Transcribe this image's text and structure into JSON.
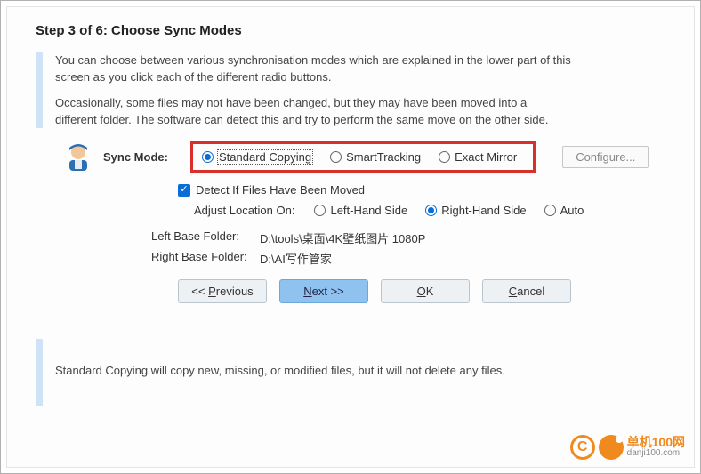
{
  "title": "Step 3 of 6: Choose Sync Modes",
  "intro": {
    "p1": "You can choose between various synchronisation modes which are explained in the lower part of this screen as you click each of the different radio buttons.",
    "p2": "Occasionally, some files may not have been changed, but they may have been moved into a different folder. The software can detect this and try to perform the same move on the other side."
  },
  "syncMode": {
    "label": "Sync Mode:",
    "options": {
      "standard": "Standard Copying",
      "smart": "SmartTracking",
      "exact": "Exact Mirror"
    },
    "configure": "Configure..."
  },
  "detect": {
    "label": "Detect If Files Have Been Moved"
  },
  "adjust": {
    "label": "Adjust Location On:",
    "left": "Left-Hand Side",
    "right": "Right-Hand Side",
    "auto": "Auto"
  },
  "paths": {
    "leftLabel": "Left Base Folder:",
    "leftValue": "D:\\tools\\桌面\\4K壁纸图片 1080P",
    "rightLabel": "Right Base Folder:",
    "rightValue": "D:\\AI写作管家"
  },
  "buttons": {
    "prev_pre": "<<  ",
    "prev_u": "P",
    "prev_post": "revious",
    "next_pre": "",
    "next_u": "N",
    "next_post": "ext >>",
    "ok_pre": "",
    "ok_u": "O",
    "ok_post": "K",
    "cancel_pre": "",
    "cancel_u": "C",
    "cancel_post": "ancel"
  },
  "description": "Standard Copying will copy new, missing, or modified files, but it will not delete any files.",
  "watermark": {
    "cn": "单机100网",
    "en": "danji100.com"
  }
}
